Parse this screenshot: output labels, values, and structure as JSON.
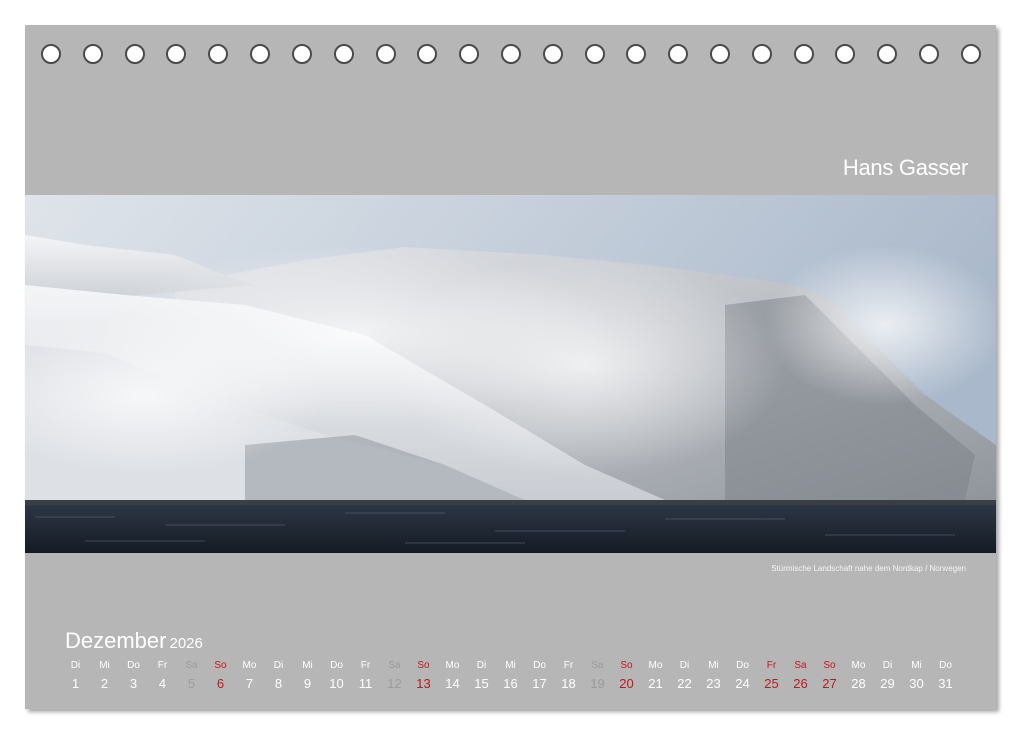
{
  "author": "Hans Gasser",
  "caption": "Stürmische Landschaft nahe dem Nordkap / Norwegen",
  "month": "Dezember",
  "year": "2026",
  "colors": {
    "background": "#b6b6b6",
    "text": "#ffffff",
    "saturday": "#9b9b9b",
    "sunday_holiday": "#c8151b"
  },
  "days": [
    {
      "dow": "Di",
      "num": "1",
      "type": "normal"
    },
    {
      "dow": "Mi",
      "num": "2",
      "type": "normal"
    },
    {
      "dow": "Do",
      "num": "3",
      "type": "normal"
    },
    {
      "dow": "Fr",
      "num": "4",
      "type": "normal"
    },
    {
      "dow": "Sa",
      "num": "5",
      "type": "sat"
    },
    {
      "dow": "So",
      "num": "6",
      "type": "hol"
    },
    {
      "dow": "Mo",
      "num": "7",
      "type": "normal"
    },
    {
      "dow": "Di",
      "num": "8",
      "type": "normal"
    },
    {
      "dow": "Mi",
      "num": "9",
      "type": "normal"
    },
    {
      "dow": "Do",
      "num": "10",
      "type": "normal"
    },
    {
      "dow": "Fr",
      "num": "11",
      "type": "normal"
    },
    {
      "dow": "Sa",
      "num": "12",
      "type": "sat"
    },
    {
      "dow": "So",
      "num": "13",
      "type": "hol"
    },
    {
      "dow": "Mo",
      "num": "14",
      "type": "normal"
    },
    {
      "dow": "Di",
      "num": "15",
      "type": "normal"
    },
    {
      "dow": "Mi",
      "num": "16",
      "type": "normal"
    },
    {
      "dow": "Do",
      "num": "17",
      "type": "normal"
    },
    {
      "dow": "Fr",
      "num": "18",
      "type": "normal"
    },
    {
      "dow": "Sa",
      "num": "19",
      "type": "sat"
    },
    {
      "dow": "So",
      "num": "20",
      "type": "hol"
    },
    {
      "dow": "Mo",
      "num": "21",
      "type": "normal"
    },
    {
      "dow": "Di",
      "num": "22",
      "type": "normal"
    },
    {
      "dow": "Mi",
      "num": "23",
      "type": "normal"
    },
    {
      "dow": "Do",
      "num": "24",
      "type": "normal"
    },
    {
      "dow": "Fr",
      "num": "25",
      "type": "hol"
    },
    {
      "dow": "Sa",
      "num": "26",
      "type": "hol"
    },
    {
      "dow": "So",
      "num": "27",
      "type": "hol"
    },
    {
      "dow": "Mo",
      "num": "28",
      "type": "normal"
    },
    {
      "dow": "Di",
      "num": "29",
      "type": "normal"
    },
    {
      "dow": "Mi",
      "num": "30",
      "type": "normal"
    },
    {
      "dow": "Do",
      "num": "31",
      "type": "normal"
    }
  ],
  "binding_holes": 23
}
